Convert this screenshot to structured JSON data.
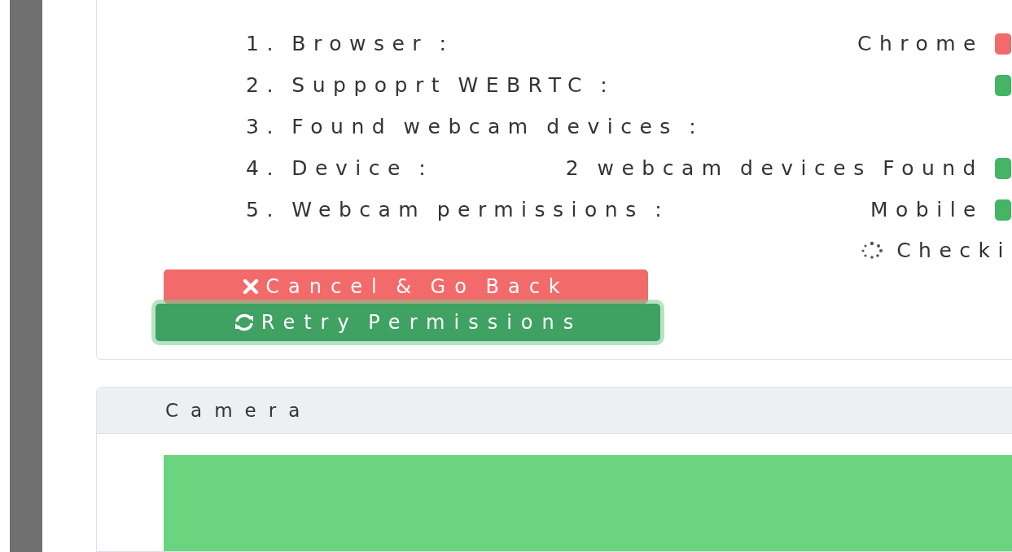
{
  "checks": [
    {
      "label": "1. Browser :",
      "value": "Chrome",
      "color": "#f26a6a"
    },
    {
      "label": "2. Suppoprt WEBRTC :",
      "color": "#43b564"
    },
    {
      "label": "3. Found webcam devices :"
    },
    {
      "label": "4. Device :",
      "value": "2 webcam devices Found",
      "color": "#43b564"
    },
    {
      "label": "5. Webcam permissions :",
      "value": "Mobile",
      "color": "#43b564"
    }
  ],
  "status": "Checki",
  "buttons": [
    {
      "kind": "cancel",
      "label": "Cancel & Go Back"
    },
    {
      "kind": "retry",
      "label": "Retry Permissions"
    }
  ],
  "camera": {
    "title": "Camera"
  }
}
